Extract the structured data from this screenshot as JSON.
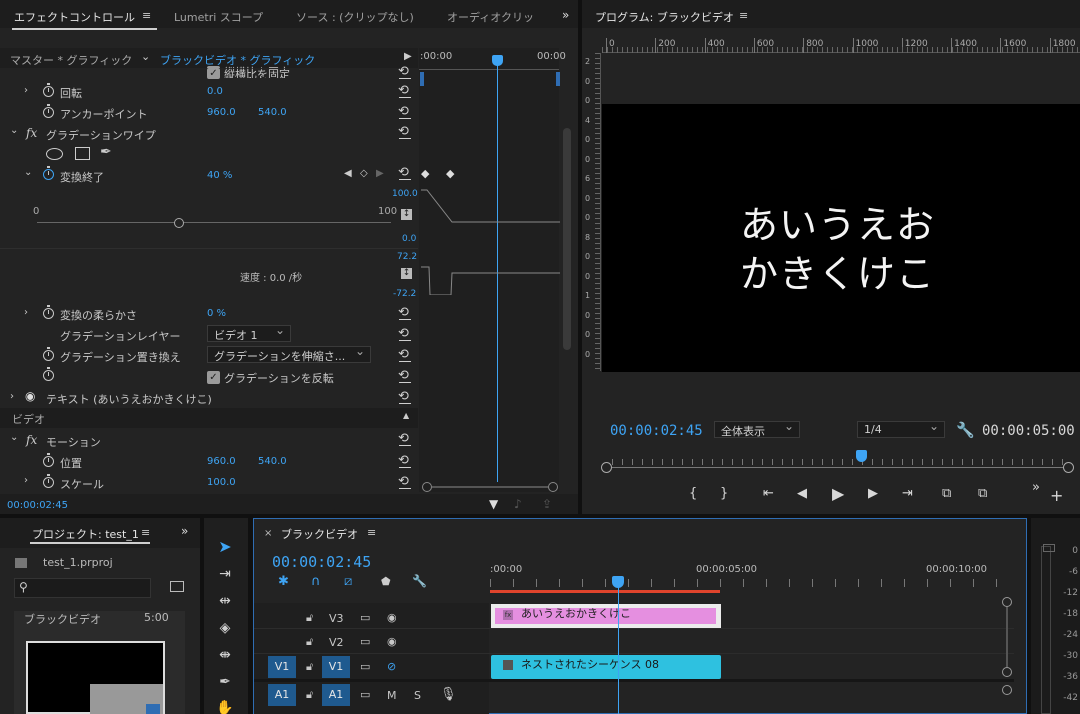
{
  "effect_controls": {
    "tabs": [
      "エフェクトコントロール",
      "Lumetri スコープ",
      "ソース : (クリップなし)",
      "オーディオクリッ"
    ],
    "master_label": "マスター * グラフィック",
    "clip_label": "ブラックビデオ * グラフィック",
    "tl_time_left": ":00:00",
    "tl_time_right": "00:00",
    "partial_row": "縦横比を固定",
    "rotation_label": "回転",
    "rotation_value": "0.0",
    "anchor_label": "アンカーポイント",
    "anchor_x": "960.0",
    "anchor_y": "540.0",
    "fx_section": "グラデーションワイプ",
    "transition_end_label": "変換終了",
    "transition_end_value": "40 %",
    "slider_min": "0",
    "slider_max": "100",
    "slider_fraction": 0.4,
    "graph_top": "100.0",
    "graph_zero": "0.0",
    "vel_top": "72.2",
    "vel_bottom": "-72.2",
    "speed_label": "速度 : 0.0 /秒",
    "softness_label": "変換の柔らかさ",
    "softness_value": "0 %",
    "layer_label": "グラデーションレイヤー",
    "layer_value": "ビデオ 1",
    "placement_label": "グラデーション置き換え",
    "placement_value": "グラデーションを伸縮さ...",
    "invert_label": "グラデーションを反転",
    "text_section": "テキスト (あいうえおかきくけこ)",
    "video_header": "ビデオ",
    "motion_label": "モーション",
    "position_label": "位置",
    "position_x": "960.0",
    "position_y": "540.0",
    "scale_label": "スケール",
    "scale_value": "100.0",
    "current_time": "00:00:02:45"
  },
  "program_monitor": {
    "title": "プログラム: ブラックビデオ",
    "ruler_ticks": [
      "0",
      "200",
      "400",
      "600",
      "800",
      "1000",
      "1200",
      "1400",
      "1600",
      "1800"
    ],
    "vruler_ticks": [
      "2",
      "0",
      "0",
      "4",
      "0",
      "0",
      "6",
      "0",
      "0",
      "8",
      "0",
      "0",
      "1",
      "0",
      "0",
      "0"
    ],
    "line1": "あいうえお",
    "line2": "かきくけこ",
    "timecode": "00:00:02:45",
    "zoom": "全体表示",
    "resolution": "1/4",
    "duration": "00:00:05:00",
    "playhead_fraction": 0.553
  },
  "project": {
    "tab": "プロジェクト: test_1",
    "file": "test_1.prproj",
    "item_name": "ブラックビデオ",
    "item_duration": "5:00"
  },
  "timeline": {
    "sequence": "ブラックビデオ",
    "timecode": "00:00:02:45",
    "ruler_labels": [
      ":00:00",
      "00:00:05:00",
      "00:00:10:00"
    ],
    "tracks": [
      "V3",
      "V2",
      "V1",
      "A1"
    ],
    "clip_text": "あいうえおかきくけこ",
    "clip_nested": "ネストされたシーケンス 08"
  },
  "audio_meter": {
    "labels": [
      "0",
      "-6",
      "-12",
      "-18",
      "-24",
      "-30",
      "-36",
      "-42"
    ]
  },
  "colors": {
    "accent": "#3ea4f4",
    "pink_clip": "#e58fe0",
    "cyan_clip": "#2ec1e0",
    "red_range": "#e0442c"
  }
}
